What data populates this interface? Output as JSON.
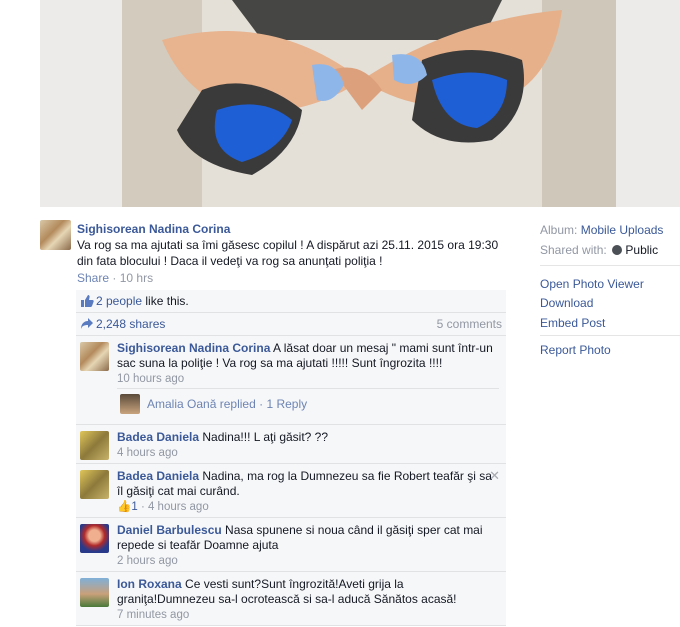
{
  "post": {
    "author": "Sighisorean Nadina Corina",
    "text": "Va rog sa ma ajutati sa îmi găsesc copilul ! A dispărut azi 25.11. 2015 ora 19:30 din fata blocului ! Daca il vedeţi va rog sa anunţati poliţia !",
    "share_label": "Share",
    "time": "10 hrs"
  },
  "ufi": {
    "likes_count": "2 people",
    "likes_suffix": "like this.",
    "shares": "2,248 shares",
    "comments_count": "5 comments"
  },
  "comments": [
    {
      "author": "Sighisorean Nadina Corina",
      "text": "A lăsat doar un mesaj \" mami sunt într-un sac suna la poliţie ! Va rog sa ma ajutati !!!!! Sunt îngrozita !!!!",
      "time": "10 hours ago"
    },
    {
      "author": "Badea Daniela",
      "text": "Nadina!!! L aţi găsit? ??",
      "time": "4 hours ago"
    },
    {
      "author": "Badea Daniela",
      "text": "Nadina, ma rog la Dumnezeu sa fie Robert teafăr şi sa îl găsiţi cat mai curând.",
      "likes": "1",
      "time": "4 hours ago"
    },
    {
      "author": "Daniel Barbulescu",
      "text": "Nasa spunene si noua când il găsiţi sper cat mai repede si teafăr Doamne ajuta",
      "time": "2 hours ago"
    },
    {
      "author": "Ion Roxana",
      "text": "Ce vesti sunt?Sunt îngrozită!Aveti grija la graniţa!Dumnezeu sa-l ocrotească si sa-l aducă Sănătos acasă!",
      "time": "7 minutes ago"
    }
  ],
  "reply": {
    "author": "Amalia Oană",
    "action": "replied",
    "separator": "·",
    "count": "1 Reply"
  },
  "sidebar": {
    "album_label": "Album:",
    "album_value": "Mobile Uploads",
    "shared_label": "Shared with:",
    "shared_value": "Public",
    "links": [
      "Open Photo Viewer",
      "Download",
      "Embed Post"
    ],
    "report": "Report Photo"
  },
  "colors": {
    "link": "#3b5998",
    "meta": "#9197a3",
    "ufi_bg": "#f6f7f8",
    "shoe_blue": "#1f5fd6"
  }
}
